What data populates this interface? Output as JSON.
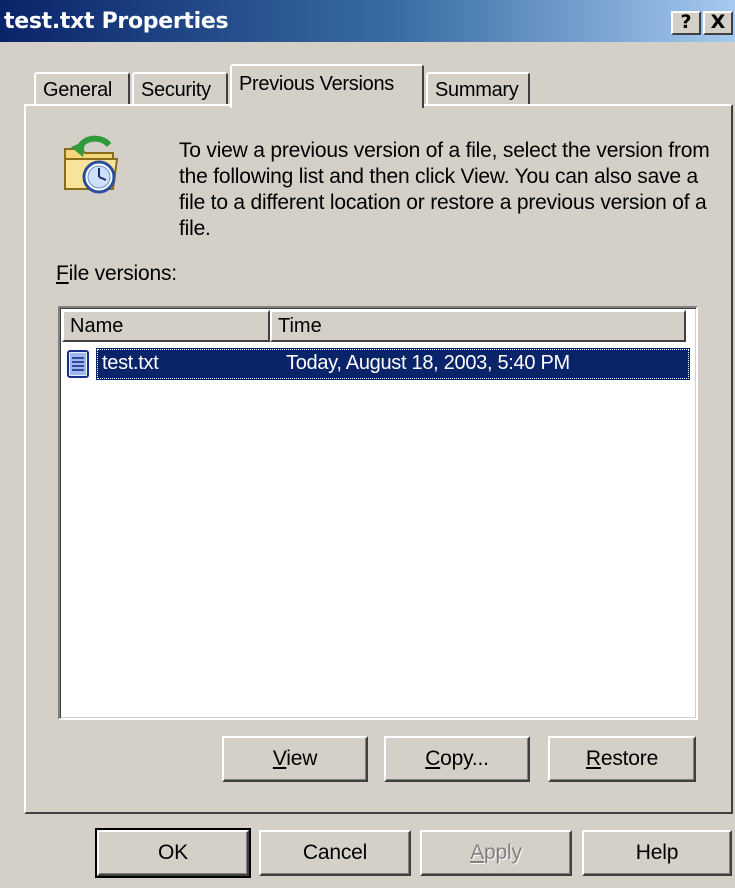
{
  "window": {
    "title": "test.txt Properties",
    "help_button": "?",
    "close_button": "X"
  },
  "tabs": [
    {
      "label": "General",
      "active": false
    },
    {
      "label": "Security",
      "active": false
    },
    {
      "label": "Previous Versions",
      "active": true
    },
    {
      "label": "Summary",
      "active": false
    }
  ],
  "content": {
    "description": "To view a previous version of a file, select the version from the following list and then click View.  You can also save a file to a different location or restore a previous version of a file.",
    "file_versions_label_hotkey": "F",
    "file_versions_label_rest": "ile versions:"
  },
  "list": {
    "columns": [
      "Name",
      "Time"
    ],
    "rows": [
      {
        "name": "test.txt",
        "time": "Today, August 18, 2003, 5:40 PM",
        "selected": true
      }
    ]
  },
  "actions": {
    "view": {
      "hotkey": "V",
      "rest": "iew"
    },
    "copy": {
      "hotkey": "C",
      "rest": "opy..."
    },
    "restore": {
      "hotkey": "R",
      "rest": "estore"
    }
  },
  "dialog_buttons": {
    "ok": "OK",
    "cancel": "Cancel",
    "apply_hotkey": "A",
    "apply_rest": "pply",
    "help": "Help"
  },
  "colors": {
    "title_gradient_start": "#0a246a",
    "title_gradient_end": "#a6caf0",
    "face": "#d4d0c8",
    "selection": "#0a246a"
  }
}
